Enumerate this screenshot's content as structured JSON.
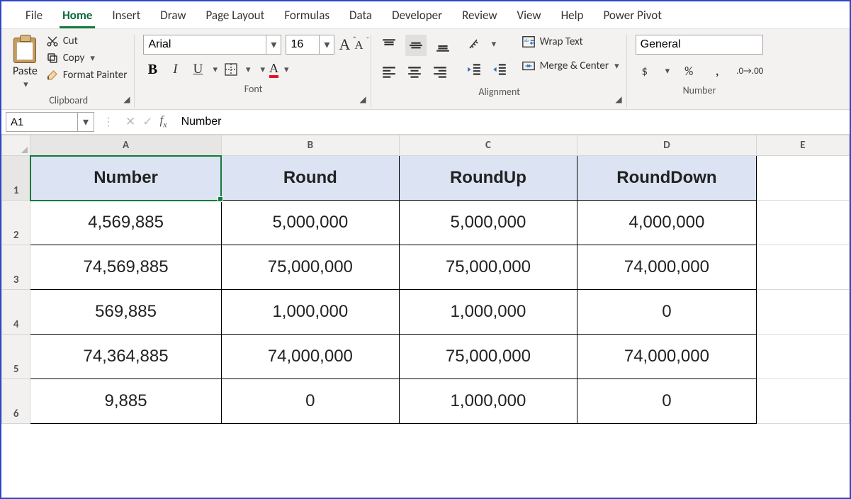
{
  "menu": {
    "items": [
      "File",
      "Home",
      "Insert",
      "Draw",
      "Page Layout",
      "Formulas",
      "Data",
      "Developer",
      "Review",
      "View",
      "Help",
      "Power Pivot"
    ],
    "active": 1
  },
  "clipboard": {
    "paste": "Paste",
    "cut": "Cut",
    "copy": "Copy",
    "painter": "Format Painter",
    "label": "Clipboard"
  },
  "font": {
    "name": "Arial",
    "size": "16",
    "label": "Font"
  },
  "alignment": {
    "wrap": "Wrap Text",
    "merge": "Merge & Center",
    "label": "Alignment"
  },
  "number": {
    "format": "General",
    "label": "Number"
  },
  "formula_bar": {
    "cell_ref": "A1",
    "value": "Number"
  },
  "columns": [
    "A",
    "B",
    "C",
    "D",
    "E"
  ],
  "sheet": {
    "headers": [
      "Number",
      "Round",
      "RoundUp",
      "RoundDown"
    ],
    "rows": [
      [
        "4,569,885",
        "5,000,000",
        "5,000,000",
        "4,000,000"
      ],
      [
        "74,569,885",
        "75,000,000",
        "75,000,000",
        "74,000,000"
      ],
      [
        "569,885",
        "1,000,000",
        "1,000,000",
        "0"
      ],
      [
        "74,364,885",
        "74,000,000",
        "75,000,000",
        "74,000,000"
      ],
      [
        "9,885",
        "0",
        "1,000,000",
        "0"
      ]
    ]
  },
  "selected": {
    "row": 0,
    "col": 0
  }
}
